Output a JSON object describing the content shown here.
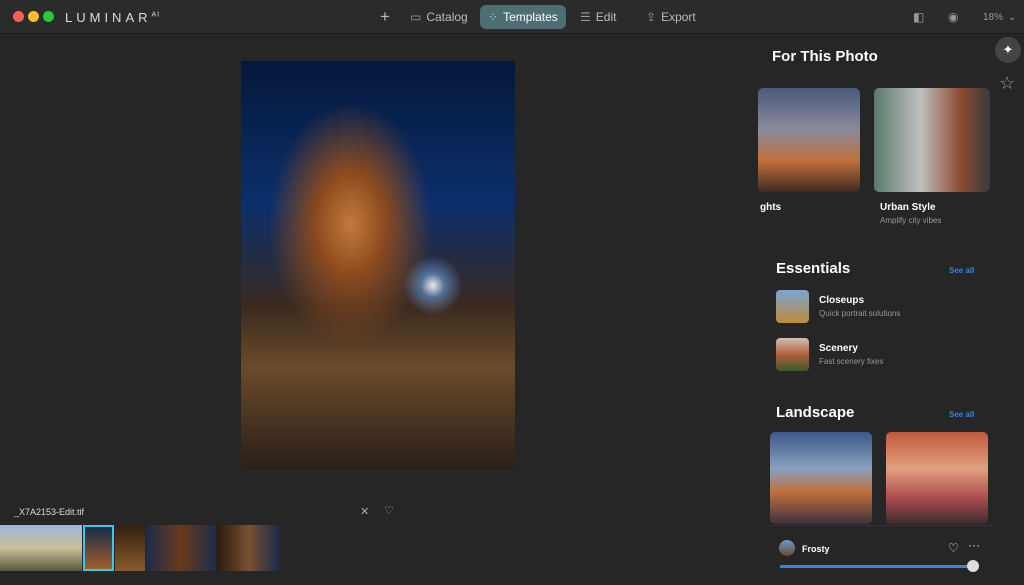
{
  "app": {
    "name": "LUMINAR",
    "sup": "AI"
  },
  "nav": {
    "add": "+",
    "catalog": "Catalog",
    "templates": "Templates",
    "edit": "Edit",
    "export": "Export",
    "zoom": "18%"
  },
  "file": {
    "name": "_X7A2153-Edit.tif"
  },
  "panel": {
    "for_this_photo": "For This Photo",
    "cards": [
      {
        "title": "ghts"
      },
      {
        "title": "Urban Style",
        "subtitle": "Amplify city vibes"
      }
    ],
    "essentials": {
      "title": "Essentials",
      "see_all": "See all",
      "items": [
        {
          "title": "Closeups",
          "subtitle": "Quick portrait solutions"
        },
        {
          "title": "Scenery",
          "subtitle": "Fast scenery fixes"
        }
      ]
    },
    "landscape": {
      "title": "Landscape",
      "see_all": "See all"
    },
    "applied": {
      "name": "Frosty",
      "amount": 100
    }
  },
  "colors": {
    "accent": "#2e86e8",
    "active_tab": "#4d6e73"
  }
}
